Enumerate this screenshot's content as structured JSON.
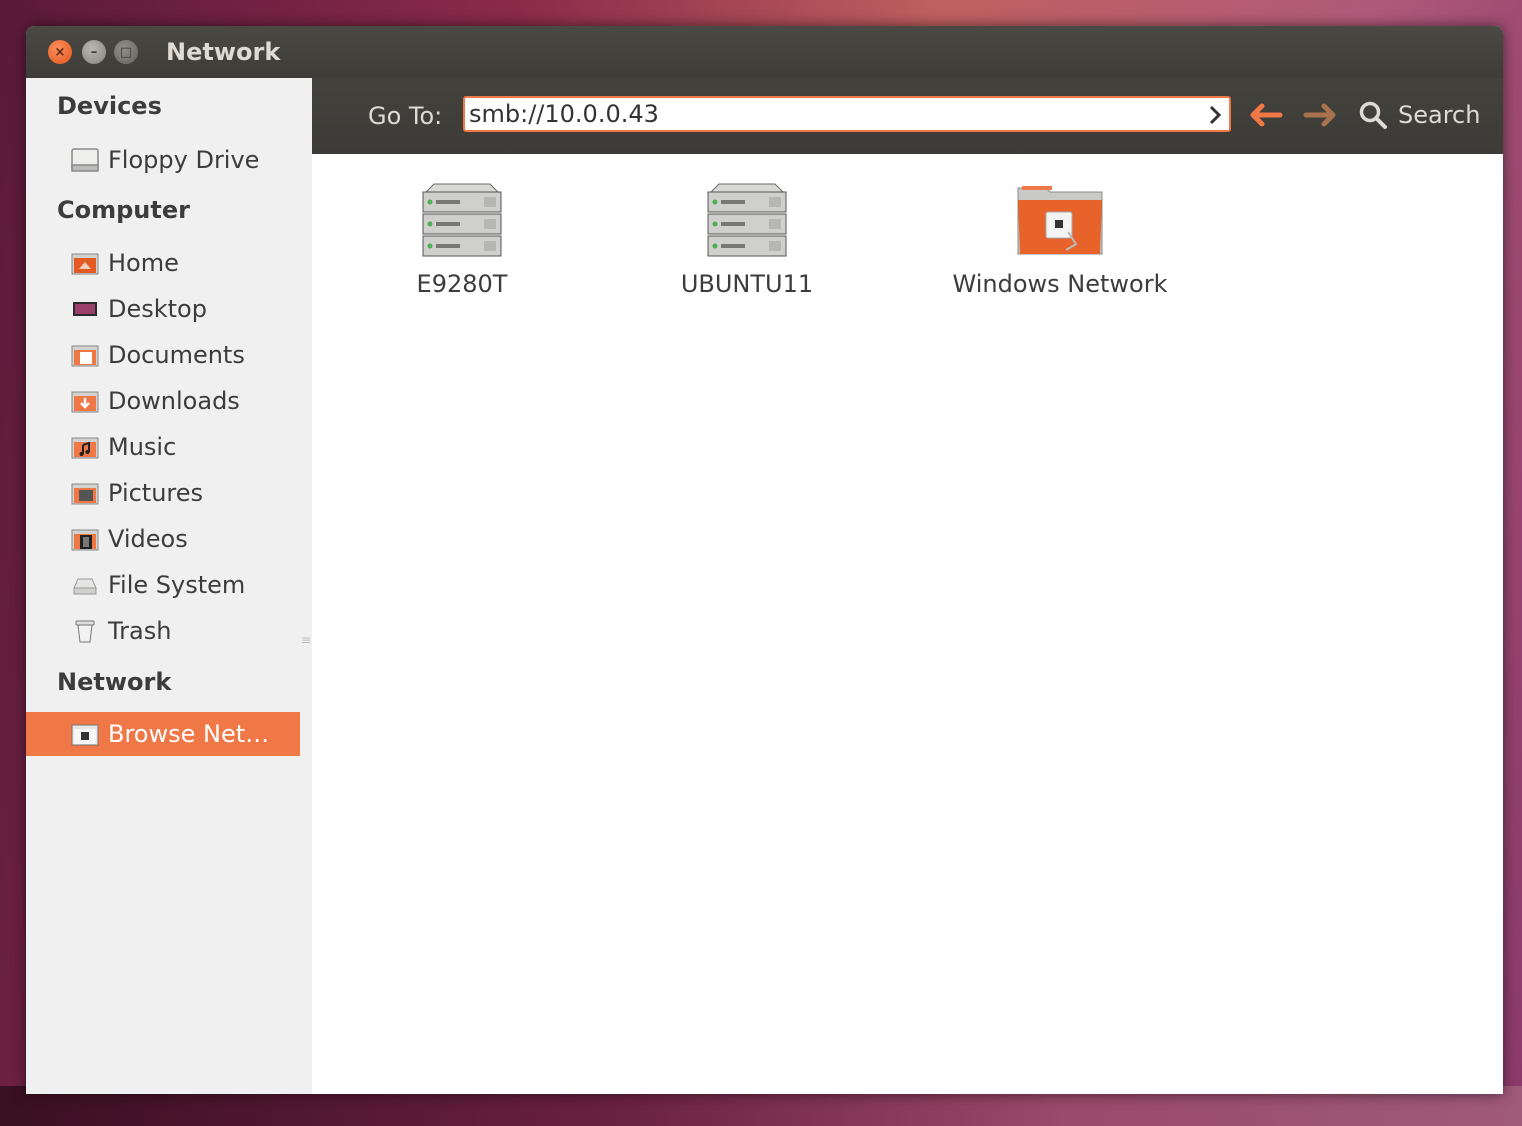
{
  "window": {
    "title": "Network"
  },
  "sidebar": {
    "headings": {
      "devices": "Devices",
      "computer": "Computer",
      "network": "Network"
    },
    "devices": [
      {
        "label": "Floppy Drive",
        "icon": "floppy-drive-icon"
      }
    ],
    "computer": [
      {
        "label": "Home",
        "icon": "home-folder-icon"
      },
      {
        "label": "Desktop",
        "icon": "desktop-icon"
      },
      {
        "label": "Documents",
        "icon": "documents-folder-icon"
      },
      {
        "label": "Downloads",
        "icon": "downloads-folder-icon"
      },
      {
        "label": "Music",
        "icon": "music-folder-icon"
      },
      {
        "label": "Pictures",
        "icon": "pictures-folder-icon"
      },
      {
        "label": "Videos",
        "icon": "videos-folder-icon"
      },
      {
        "label": "File System",
        "icon": "file-system-icon"
      },
      {
        "label": "Trash",
        "icon": "trash-icon"
      }
    ],
    "network": [
      {
        "label": "Browse Net…",
        "icon": "network-folder-icon",
        "selected": true
      }
    ]
  },
  "toolbar": {
    "goto_label": "Go To:",
    "location_value": "smb://10.0.0.43",
    "search_label": "Search"
  },
  "content": {
    "items": [
      {
        "name": "E9280T",
        "icon": "server-icon"
      },
      {
        "name": "UBUNTU11",
        "icon": "server-icon"
      },
      {
        "name": "Windows Network",
        "icon": "network-folder-icon"
      }
    ]
  },
  "colors": {
    "accent": "#f07746",
    "titlebar": "#3c3b37",
    "sidebar_bg": "#f0f0f0"
  }
}
